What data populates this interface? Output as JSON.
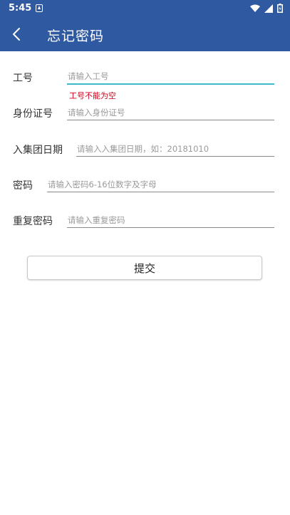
{
  "status_bar": {
    "time": "5:45",
    "icons": [
      "notification-icon",
      "wifi-icon",
      "signal-icon",
      "battery-icon"
    ]
  },
  "app_bar": {
    "title": "忘记密码",
    "back_icon": "chevron-left-icon",
    "color": "#2f59a0"
  },
  "form": {
    "employee_id": {
      "label": "工号",
      "placeholder": "请输入工号",
      "error": "工号不能为空"
    },
    "id_number": {
      "label": "身份证号",
      "placeholder": "请输入身份证号"
    },
    "join_date": {
      "label": "入集团日期",
      "placeholder": "请输入入集团日期，如：20181010"
    },
    "password": {
      "label": "密码",
      "placeholder": "请输入密码6-16位数字及字母"
    },
    "confirm_password": {
      "label": "重复密码",
      "placeholder": "请输入重复密码"
    }
  },
  "submit": {
    "label": "提交"
  },
  "colors": {
    "accent": "#3fb8c9",
    "error": "#d0021b"
  }
}
